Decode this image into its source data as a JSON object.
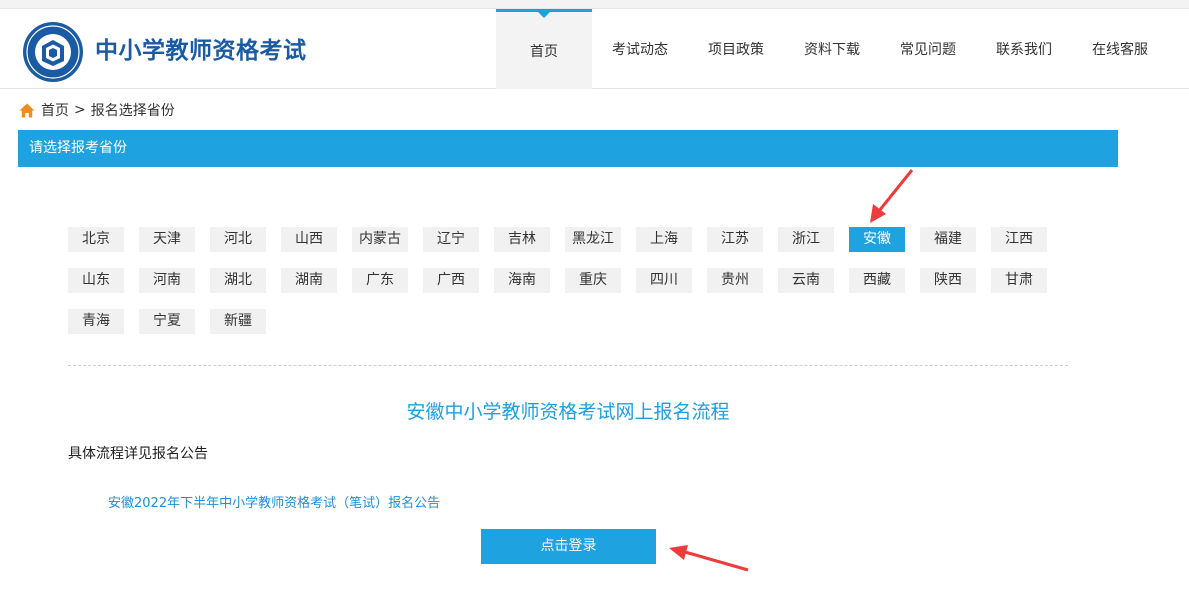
{
  "header": {
    "site_title": "中小学教师资格考试",
    "nav": [
      {
        "label": "首页",
        "active": true
      },
      {
        "label": "考试动态",
        "active": false
      },
      {
        "label": "项目政策",
        "active": false
      },
      {
        "label": "资料下载",
        "active": false
      },
      {
        "label": "常见问题",
        "active": false
      },
      {
        "label": "联系我们",
        "active": false
      },
      {
        "label": "在线客服",
        "active": false
      }
    ]
  },
  "breadcrumb": {
    "home": "首页",
    "separator": ">",
    "current": "报名选择省份"
  },
  "section_title": "请选择报考省份",
  "provinces": [
    "北京",
    "天津",
    "河北",
    "山西",
    "内蒙古",
    "辽宁",
    "吉林",
    "黑龙江",
    "上海",
    "江苏",
    "浙江",
    "安徽",
    "福建",
    "江西",
    "山东",
    "河南",
    "湖北",
    "湖南",
    "广东",
    "广西",
    "海南",
    "重庆",
    "四川",
    "贵州",
    "云南",
    "西藏",
    "陕西",
    "甘肃",
    "青海",
    "宁夏",
    "新疆"
  ],
  "selected_province": "安徽",
  "flow": {
    "title": "安徽中小学教师资格考试网上报名流程",
    "description": "具体流程详见报名公告",
    "notice_link": "安徽2022年下半年中小学教师资格考试（笔试）报名公告",
    "login_button": "点击登录"
  },
  "colors": {
    "accent": "#1ea3e0",
    "brand_title": "#1b5ba3",
    "annotation_arrow": "#ee3b3b"
  }
}
